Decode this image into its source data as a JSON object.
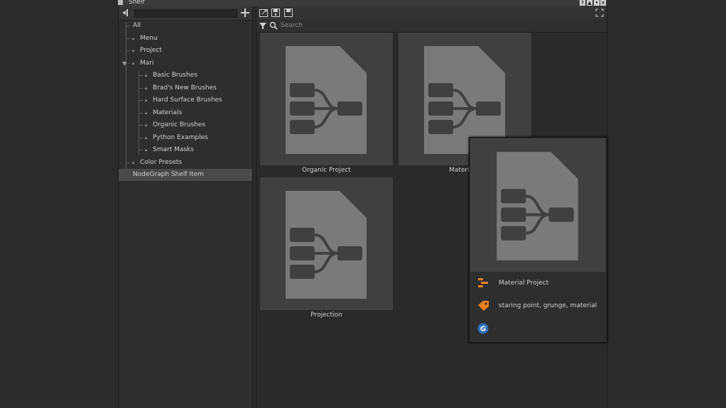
{
  "window": {
    "title": "Shelf"
  },
  "left_panel": {
    "tree": [
      {
        "label": "All",
        "locked": false
      },
      {
        "label": "Menu",
        "locked": true
      },
      {
        "label": "Project",
        "locked": true
      },
      {
        "label": "Mari",
        "locked": true,
        "expanded": true
      },
      {
        "label": "Basic Brushes",
        "locked": true
      },
      {
        "label": "Brad's New Brushes",
        "locked": true
      },
      {
        "label": "Hard Surface Brushes",
        "locked": true
      },
      {
        "label": "Materials",
        "locked": true
      },
      {
        "label": "Organic Brushes",
        "locked": true
      },
      {
        "label": "Python Examples",
        "locked": true
      },
      {
        "label": "Smart Masks",
        "locked": true
      },
      {
        "label": "Color Presets",
        "locked": true
      },
      {
        "label": "NodeGraph Shelf Item",
        "locked": false,
        "selected": true
      }
    ]
  },
  "right_panel": {
    "search_placeholder": "Search",
    "items": [
      {
        "label": "Organic Project",
        "icon": "nodegraph-file-icon"
      },
      {
        "label": "Material P",
        "icon": "nodegraph-file-icon"
      },
      {
        "label": "Projection",
        "icon": "nodegraph-file-icon"
      }
    ]
  },
  "popup": {
    "name": "Material Project",
    "tags": "staring point, grunge, material",
    "badge_letter": "G",
    "colors": {
      "accent": "#e8801e",
      "badge": "#2d6fb5"
    }
  }
}
